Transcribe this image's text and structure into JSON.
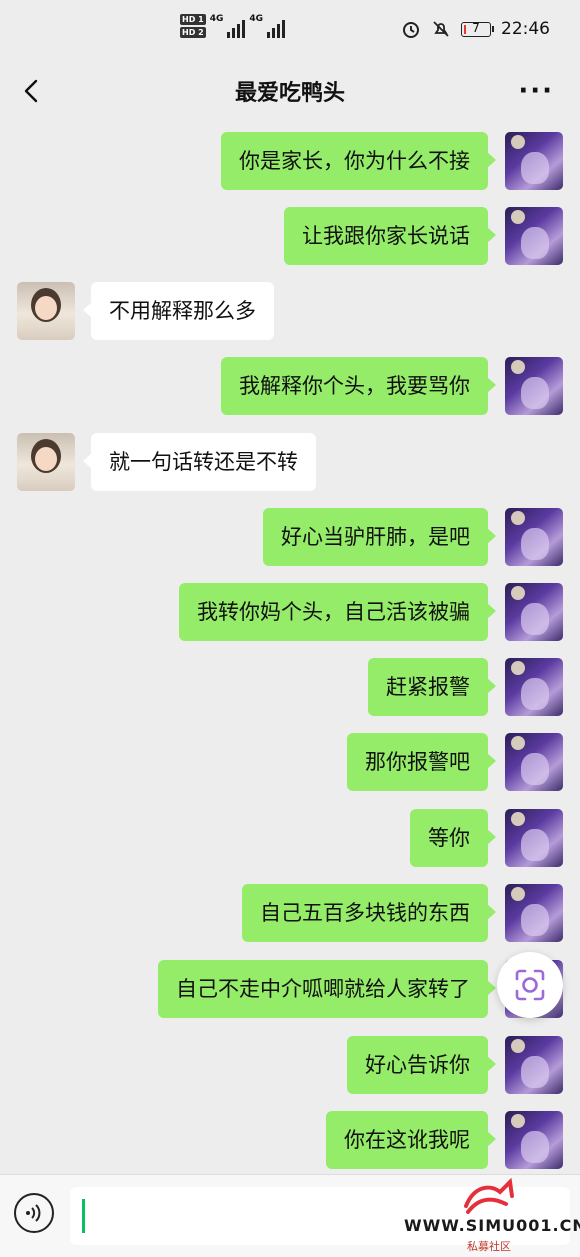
{
  "status_bar": {
    "hd1": "HD 1",
    "hd2": "HD 2",
    "network": "4G",
    "network2": "4G",
    "battery": "7",
    "battery_level": 0.07,
    "time": "22:46"
  },
  "header": {
    "title": "最爱吃鸭头",
    "back_icon": "chevron-left-icon",
    "more_label": "···"
  },
  "messages": [
    {
      "sender": "self",
      "text": "你是家长，你为什么不接"
    },
    {
      "sender": "self",
      "text": "让我跟你家长说话"
    },
    {
      "sender": "other",
      "text": "不用解释那么多"
    },
    {
      "sender": "self",
      "text": "我解释你个头，我要骂你"
    },
    {
      "sender": "other",
      "text": "就一句话转还是不转"
    },
    {
      "sender": "self",
      "text": "好心当驴肝肺，是吧"
    },
    {
      "sender": "self",
      "text": "我转你妈个头，自己活该被骗"
    },
    {
      "sender": "self",
      "text": "赶紧报警"
    },
    {
      "sender": "self",
      "text": "那你报警吧"
    },
    {
      "sender": "self",
      "text": "等你"
    },
    {
      "sender": "self",
      "text": "自己五百多块钱的东西"
    },
    {
      "sender": "self",
      "text": "自己不走中介呱唧就给人家转了"
    },
    {
      "sender": "self",
      "text": "好心告诉你"
    },
    {
      "sender": "self",
      "text": "你在这讹我呢"
    }
  ],
  "floating": {
    "scan_icon": "screen-capture-icon"
  },
  "input_bar": {
    "voice_icon": "voice-icon",
    "value": ""
  },
  "watermark": {
    "text": "WWW.SIMU001.CN",
    "sub": "私募社区"
  },
  "colors": {
    "self_bubble": "#95ec69",
    "other_bubble": "#ffffff",
    "background": "#ededed",
    "accent": "#07c160"
  }
}
